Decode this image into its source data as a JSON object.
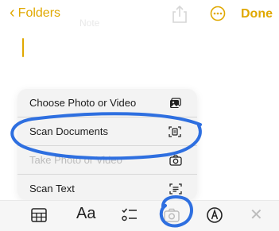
{
  "header": {
    "back_label": "Folders",
    "ghost_title": "Note",
    "done_label": "Done"
  },
  "menu": {
    "items": [
      {
        "label": "Choose Photo or Video",
        "icon": "photo-icon"
      },
      {
        "label": "Scan Documents",
        "icon": "scan-document-icon"
      },
      {
        "label": "Take Photo or Video",
        "icon": "camera-icon"
      },
      {
        "label": "Scan Text",
        "icon": "scan-text-icon"
      }
    ]
  },
  "toolbar": {
    "format_label": "Aa",
    "buttons": [
      "table-icon",
      "format-text-icon",
      "checklist-icon",
      "camera-icon",
      "markup-icon",
      "close-icon"
    ]
  },
  "colors": {
    "accent": "#e0a800",
    "highlight": "#2e6fe0"
  }
}
